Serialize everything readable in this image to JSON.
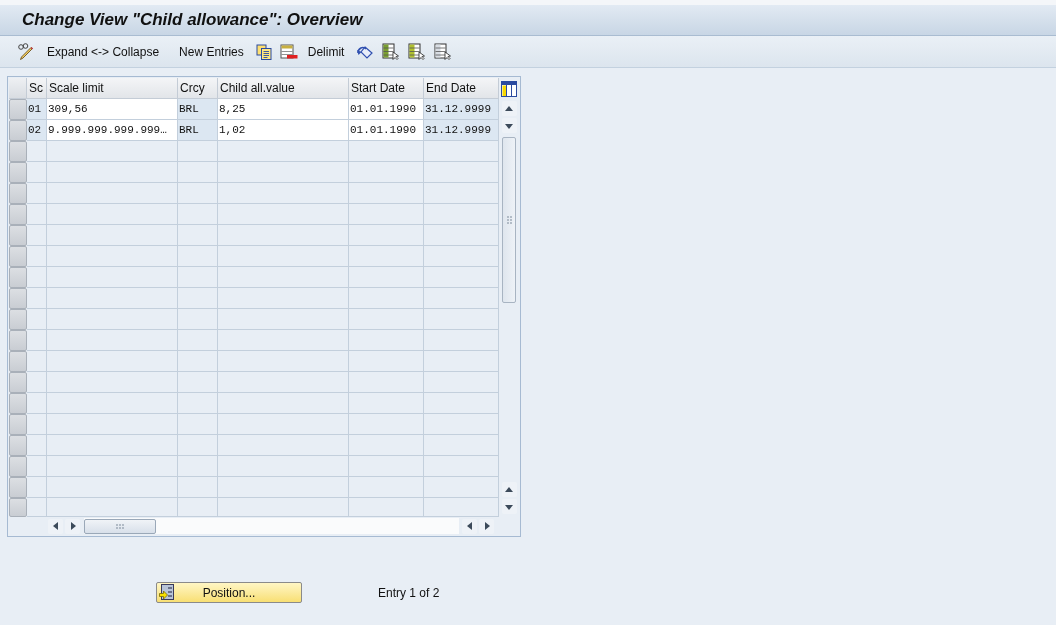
{
  "window": {
    "title": "Change View \"Child allowance\": Overview"
  },
  "toolbar": [
    "Expand <-> Collapse",
    "New Entries",
    "Delimit"
  ],
  "table": {
    "columns": [
      {
        "label": "Sc",
        "editable": false
      },
      {
        "label": "Scale limit",
        "editable": true
      },
      {
        "label": "Crcy",
        "editable": false
      },
      {
        "label": "Child all.value",
        "editable": true
      },
      {
        "label": "Start Date",
        "editable": true
      },
      {
        "label": "End Date",
        "editable": false
      }
    ],
    "rows": [
      {
        "cells": [
          "01",
          "309,56",
          "BRL",
          "8,25",
          "01.01.1990",
          "31.12.9999"
        ]
      },
      {
        "cells": [
          "02",
          "9.999.999.999.999…",
          "BRL",
          "1,02",
          "01.01.1990",
          "31.12.9999"
        ]
      }
    ]
  },
  "position_button": {
    "label": "Position..."
  },
  "entry_info": "Entry 1 of 2"
}
